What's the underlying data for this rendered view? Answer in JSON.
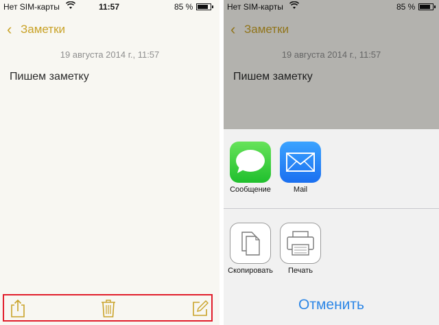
{
  "left_screen": {
    "status": {
      "carrier": "Нет SIM-карты",
      "time": "11:57",
      "battery_percent_text": "85 %",
      "battery_level": 0.85
    },
    "nav": {
      "back_label": "Заметки"
    },
    "note": {
      "date": "19 августа 2014 г., 11:57",
      "text": "Пишем заметку"
    },
    "toolbar": {
      "icons": [
        "share-icon",
        "trash-icon",
        "compose-icon"
      ]
    }
  },
  "right_screen": {
    "status": {
      "carrier": "Нет SIM-карты",
      "battery_percent_text": "85 %",
      "battery_level": 0.85
    },
    "nav": {
      "back_label": "Заметки"
    },
    "note": {
      "date": "19 августа 2014 г., 11:57",
      "text": "Пишем заметку"
    },
    "share_sheet": {
      "apps": [
        {
          "label": "Сообщение",
          "icon": "messages-icon"
        },
        {
          "label": "Mail",
          "icon": "mail-icon"
        }
      ],
      "actions": [
        {
          "label": "Скопировать",
          "icon": "copy-icon"
        },
        {
          "label": "Печать",
          "icon": "print-icon"
        }
      ],
      "cancel_label": "Отменить"
    }
  },
  "colors": {
    "accent_gold": "#c9a227",
    "ios_blue": "#2c86e6",
    "highlight_red": "#e11d2b",
    "paper": "#f8f7f2"
  }
}
